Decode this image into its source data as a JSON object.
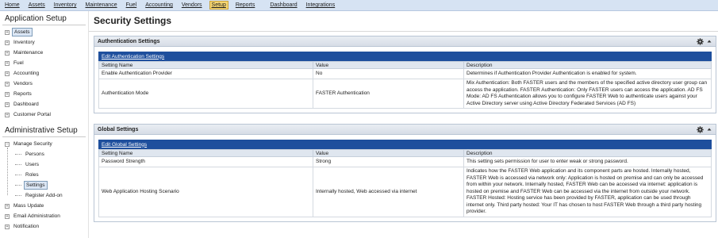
{
  "menu": {
    "items": [
      {
        "label": "Home",
        "active": false
      },
      {
        "label": "Assets",
        "active": false
      },
      {
        "label": "Inventory",
        "active": false
      },
      {
        "label": "Maintenance",
        "active": false
      },
      {
        "label": "Fuel",
        "active": false
      },
      {
        "label": "Accounting",
        "active": false
      },
      {
        "label": "Vendors",
        "active": false
      },
      {
        "label": "Setup",
        "active": true
      },
      {
        "label": "Reports",
        "active": false
      },
      {
        "label": "Dashboard",
        "active": false
      },
      {
        "label": "Integrations",
        "active": false
      }
    ]
  },
  "sidebar": {
    "app_setup_title": "Application Setup",
    "app_items": [
      "Assets",
      "Inventory",
      "Maintenance",
      "Fuel",
      "Accounting",
      "Vendors",
      "Reports",
      "Dashboard",
      "Customer Portal"
    ],
    "admin_setup_title": "Administrative Setup",
    "admin_items": {
      "manage_security": "Manage Security",
      "security_children": [
        "Persons",
        "Users",
        "Roles",
        "Settings",
        "Register Add-on"
      ],
      "others": [
        "Mass Update",
        "Email Administration",
        "Notification"
      ]
    }
  },
  "main": {
    "title": "Security Settings",
    "columns": {
      "name": "Setting Name",
      "value": "Value",
      "description": "Description"
    },
    "auth_panel": {
      "title": "Authentication Settings",
      "edit_link": "Edit Authentication Settings",
      "rows": [
        {
          "name": "Enable Authentication Provider",
          "value": "No",
          "description": "Determines if Authentication Provider Authentication is enabled for system."
        },
        {
          "name": "Authentication Mode",
          "value": "FASTER Authentication",
          "description": "Mix Authentication: Both FASTER users and the members of the specified active directory user group can access the application. FASTER Authentication: Only FASTER users can access the application. AD FS Mode: AD FS Authentication allows you to configure FASTER Web to authenticate users against your Active Directory server using Active Directory Federated Services (AD FS)"
        }
      ]
    },
    "global_panel": {
      "title": "Global Settings",
      "edit_link": "Edit Global Settings",
      "rows": [
        {
          "name": "Password Strength",
          "value": "Strong",
          "description": "This setting sets permission for user to enter weak or strong password."
        },
        {
          "name": "Web Application Hosting Scenario",
          "value": "Internally hosted, Web accessed via internet",
          "description": "Indicates how the FASTER Web application and its component parts are hosted. Internally hosted, FASTER Web is accessed via network only: Application is hosted on premise and can only be accessed from within your network. Internally hosted, FASTER Web can be accessed via internet: application is hosted on premise and FASTER Web can be accessed via the internet from outside your network. FASTER Hosted: Hosting service has been provided by FASTER, application can be used through internet only. Third party hosted: Your IT has chosen to host FASTER Web through a third party hosting provider."
        }
      ]
    }
  },
  "colors": {
    "menubar": "#d6e3f3",
    "active_menu": "#f7d774",
    "edit_bar": "#1e4f9d",
    "panel_header": "#d7dde6"
  },
  "icons": {
    "panel_tools": "gear-icon",
    "panel_toggle": "collapse-icon",
    "tree_toggle": "expand-icon"
  }
}
